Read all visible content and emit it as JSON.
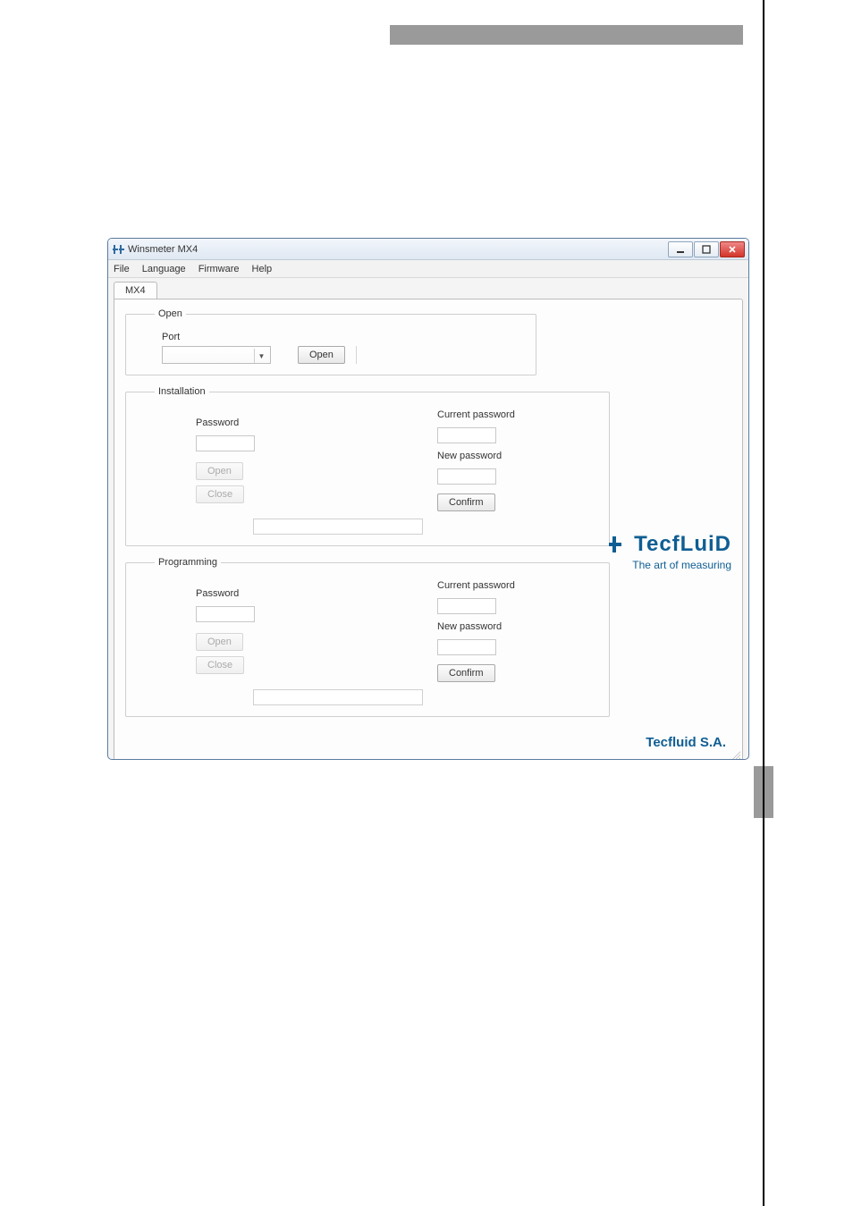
{
  "window_title": "Winsmeter MX4",
  "menu": {
    "file": "File",
    "language": "Language",
    "firmware": "Firmware",
    "help": "Help"
  },
  "tab": "MX4",
  "open_group": {
    "legend": "Open",
    "port_label": "Port",
    "open_btn": "Open"
  },
  "installation_group": {
    "legend": "Installation",
    "password_label": "Password",
    "open_btn": "Open",
    "close_btn": "Close",
    "current_password_label": "Current password",
    "new_password_label": "New password",
    "confirm_btn": "Confirm"
  },
  "programming_group": {
    "legend": "Programming",
    "password_label": "Password",
    "open_btn": "Open",
    "close_btn": "Close",
    "current_password_label": "Current password",
    "new_password_label": "New password",
    "confirm_btn": "Confirm"
  },
  "brand": {
    "name": "TecfLuiD",
    "tagline": "The art of measuring",
    "footer": "Tecfluid S.A."
  }
}
